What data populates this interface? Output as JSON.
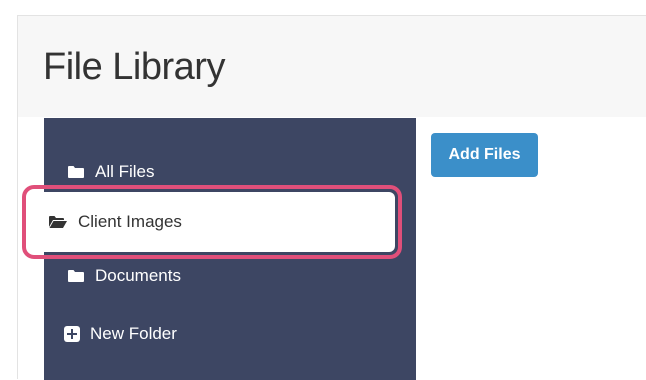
{
  "page": {
    "title": "File Library"
  },
  "sidebar": {
    "items": [
      {
        "label": "All Files",
        "icon": "folder-icon"
      },
      {
        "label": "Client Images",
        "icon": "folder-open-icon",
        "selected": true
      },
      {
        "label": "Documents",
        "icon": "folder-icon"
      }
    ],
    "new_folder_label": "New Folder",
    "new_folder_icon": "plus-square-icon"
  },
  "toolbar": {
    "add_files_label": "Add Files"
  },
  "colors": {
    "sidebar_bg": "#3d4663",
    "highlight_outline": "#e04f7a",
    "primary_button": "#3b8fc9",
    "title_text": "#333333"
  }
}
